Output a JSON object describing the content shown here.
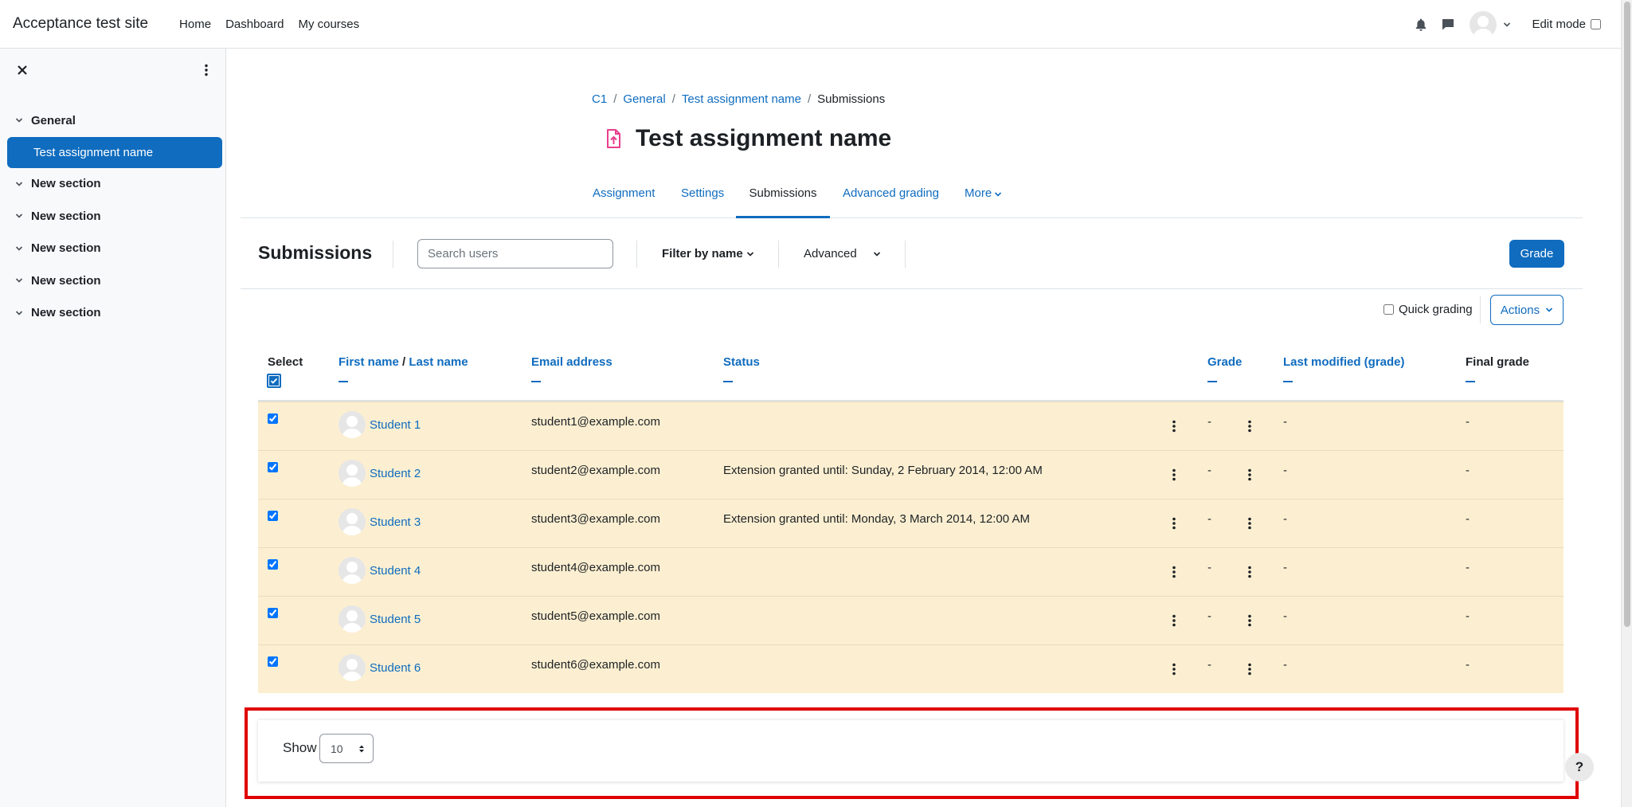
{
  "site": {
    "name": "Acceptance test site"
  },
  "primary_nav": [
    "Home",
    "Dashboard",
    "My courses"
  ],
  "user_menu": {
    "edit_mode_label": "Edit mode"
  },
  "drawer": {
    "sections": [
      {
        "label": "General",
        "activities": [
          "Test assignment name"
        ]
      },
      {
        "label": "New section"
      },
      {
        "label": "New section"
      },
      {
        "label": "New section"
      },
      {
        "label": "New section"
      },
      {
        "label": "New section"
      }
    ]
  },
  "breadcrumb": [
    "C1",
    "General",
    "Test assignment name",
    "Submissions"
  ],
  "page": {
    "title": "Test assignment name"
  },
  "secondary_nav": {
    "tabs": [
      "Assignment",
      "Settings",
      "Submissions",
      "Advanced grading",
      "More"
    ],
    "active": "Submissions"
  },
  "toolbar": {
    "title": "Submissions",
    "search_placeholder": "Search users",
    "filter_by_name": "Filter by name",
    "advanced": "Advanced",
    "grade_button": "Grade"
  },
  "quick_grading_label": "Quick grading",
  "actions_label": "Actions",
  "table": {
    "headers": {
      "select": "Select",
      "first_name": "First name",
      "slash": "/",
      "last_name": "Last name",
      "email": "Email address",
      "status": "Status",
      "grade": "Grade",
      "last_modified": "Last modified (grade)",
      "final_grade": "Final grade"
    },
    "rows": [
      {
        "name": "Student 1",
        "email": "student1@example.com",
        "status": "",
        "grade": "-",
        "last_modified": "-",
        "final_grade": "-"
      },
      {
        "name": "Student 2",
        "email": "student2@example.com",
        "status": "Extension granted until: Sunday, 2 February 2014, 12:00 AM",
        "grade": "-",
        "last_modified": "-",
        "final_grade": "-"
      },
      {
        "name": "Student 3",
        "email": "student3@example.com",
        "status": "Extension granted until: Monday, 3 March 2014, 12:00 AM",
        "grade": "-",
        "last_modified": "-",
        "final_grade": "-"
      },
      {
        "name": "Student 4",
        "email": "student4@example.com",
        "status": "",
        "grade": "-",
        "last_modified": "-",
        "final_grade": "-"
      },
      {
        "name": "Student 5",
        "email": "student5@example.com",
        "status": "",
        "grade": "-",
        "last_modified": "-",
        "final_grade": "-"
      },
      {
        "name": "Student 6",
        "email": "student6@example.com",
        "status": "",
        "grade": "-",
        "last_modified": "-",
        "final_grade": "-"
      }
    ]
  },
  "pagination": {
    "show_label": "Show",
    "per_page": "10"
  },
  "help_label": "?",
  "colors": {
    "brand": "#0f6cbf",
    "row_highlight": "#fcefd1",
    "annotation_red": "#e00000"
  }
}
